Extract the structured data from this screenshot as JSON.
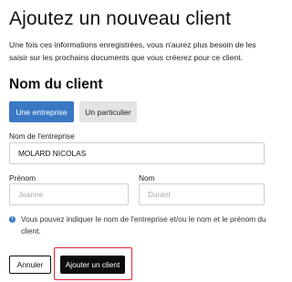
{
  "header": {
    "title": "Ajoutez un nouveau client",
    "intro": "Une fois ces informations enregistrées, vous n'aurez plus besoin de les saisir sur les prochains documents que vous créerez pour ce client."
  },
  "section": {
    "title": "Nom du client"
  },
  "client_type": {
    "options": [
      "Une entreprise",
      "Un particulier"
    ],
    "selected": "Une entreprise"
  },
  "form": {
    "company_label": "Nom de l'entreprise",
    "company_value": "MOLARD NICOLAS",
    "first_name_label": "Prénom",
    "first_name_placeholder": "Jeanne",
    "last_name_label": "Nom",
    "last_name_placeholder": "Durant"
  },
  "info": {
    "icon": "info-icon",
    "text": "Vous pouvez indiquer le nom de l'entreprise et/ou le nom et le prénom du client."
  },
  "actions": {
    "cancel_label": "Annuler",
    "add_label": "Ajouter un client"
  },
  "colors": {
    "accent": "#3a78c4",
    "primary_button": "#0c0c0c",
    "highlight_outline": "#e0262d"
  }
}
